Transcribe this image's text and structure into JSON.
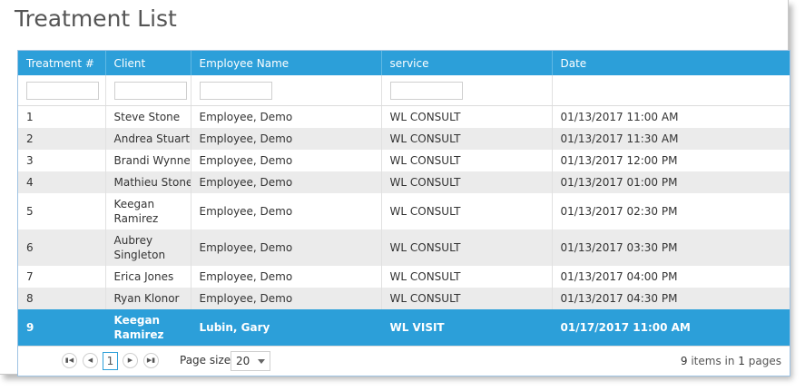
{
  "page": {
    "title": "Treatment List"
  },
  "grid": {
    "columns": [
      "Treatment #",
      "Client",
      "Employee Name",
      "service",
      "Date"
    ],
    "rows": [
      {
        "num": "1",
        "client": "Steve Stone",
        "employee": "Employee, Demo",
        "service": "WL CONSULT",
        "date": "01/13/2017 11:00 AM"
      },
      {
        "num": "2",
        "client": "Andrea Stuart",
        "employee": "Employee, Demo",
        "service": "WL CONSULT",
        "date": "01/13/2017 11:30 AM"
      },
      {
        "num": "3",
        "client": "Brandi Wynne",
        "employee": "Employee, Demo",
        "service": "WL CONSULT",
        "date": "01/13/2017 12:00 PM"
      },
      {
        "num": "4",
        "client": "Mathieu Stone",
        "employee": "Employee, Demo",
        "service": "WL CONSULT",
        "date": "01/13/2017 01:00 PM"
      },
      {
        "num": "5",
        "client": "Keegan Ramirez",
        "employee": "Employee, Demo",
        "service": "WL CONSULT",
        "date": "01/13/2017 02:30 PM"
      },
      {
        "num": "6",
        "client": "Aubrey Singleton",
        "employee": "Employee, Demo",
        "service": "WL CONSULT",
        "date": "01/13/2017 03:30 PM"
      },
      {
        "num": "7",
        "client": "Erica Jones",
        "employee": "Employee, Demo",
        "service": "WL CONSULT",
        "date": "01/13/2017 04:00 PM"
      },
      {
        "num": "8",
        "client": "Ryan Klonor",
        "employee": "Employee, Demo",
        "service": "WL CONSULT",
        "date": "01/13/2017 04:30 PM"
      },
      {
        "num": "9",
        "client": "Keegan Ramirez",
        "employee": "Lubin, Gary",
        "service": "WL VISIT",
        "date": "01/17/2017 11:00 AM"
      }
    ],
    "selected_row": "9"
  },
  "pager": {
    "first_icon": "first-page-icon",
    "prev_icon": "previous-page-icon",
    "next_icon": "next-page-icon",
    "last_icon": "last-page-icon",
    "current_page": "1",
    "page_size_label": "Page size:",
    "page_size": "20",
    "items_count": "9",
    "items_in_text": "items in",
    "pages_count": "1",
    "pages_text": "pages"
  },
  "colors": {
    "header_bg": "#2c9fd9",
    "selected_bg": "#2c9fd9",
    "alt_row_bg": "#ebebeb",
    "header_text": "#ffffff"
  }
}
